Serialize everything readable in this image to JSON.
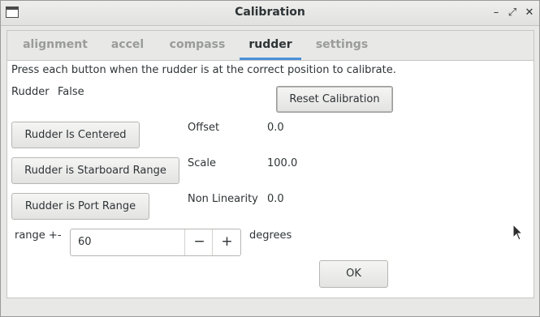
{
  "window": {
    "title": "Calibration",
    "controls": {
      "minimize": "–",
      "maximize": "⤢",
      "close": "✕"
    }
  },
  "tabs": [
    {
      "label": "alignment",
      "active": false
    },
    {
      "label": "accel",
      "active": false
    },
    {
      "label": "compass",
      "active": false
    },
    {
      "label": "rudder",
      "active": true
    },
    {
      "label": "settings",
      "active": false
    }
  ],
  "rudder": {
    "instructions": "Press each button when the rudder is at the correct position to calibrate.",
    "status_label": "Rudder",
    "status_value": "False",
    "reset_button": "Reset Calibration",
    "centered_button": "Rudder Is Centered",
    "starboard_button": "Rudder is Starboard Range",
    "port_button": "Rudder is Port Range",
    "offset_label": "Offset",
    "offset_value": "0.0",
    "scale_label": "Scale",
    "scale_value": "100.0",
    "nonlinearity_label": "Non Linearity",
    "nonlinearity_value": "0.0",
    "range_label": "range +-",
    "range_value": "60",
    "range_minus": "−",
    "range_plus": "+",
    "range_unit": "degrees"
  },
  "ok_button": "OK",
  "accent_color": "#4a90d9"
}
